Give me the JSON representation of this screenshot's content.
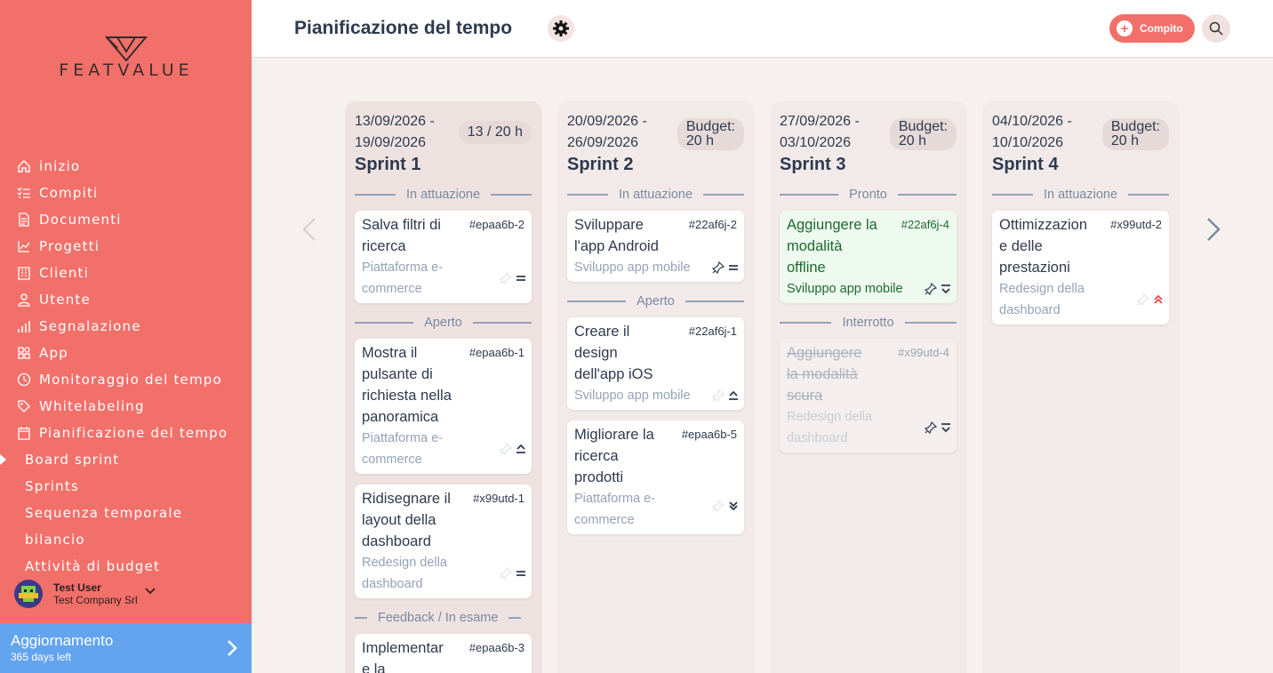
{
  "brand": {
    "name": "FEATVALUE",
    "accent": "#f2706a",
    "upgrade_color": "#63a4ee"
  },
  "sidebar": {
    "items": [
      {
        "label": "inizio",
        "icon": "home-icon"
      },
      {
        "label": "Compiti",
        "icon": "checklist-icon"
      },
      {
        "label": "Documenti",
        "icon": "document-icon"
      },
      {
        "label": "Progetti",
        "icon": "chart-icon"
      },
      {
        "label": "Clienti",
        "icon": "building-icon"
      },
      {
        "label": "Utente",
        "icon": "user-icon"
      },
      {
        "label": "Segnalazione",
        "icon": "bar-chart-icon"
      },
      {
        "label": "App",
        "icon": "apps-icon"
      },
      {
        "label": "Monitoraggio del tempo",
        "icon": "clock-icon"
      },
      {
        "label": "Whitelabeling",
        "icon": "tag-icon"
      },
      {
        "label": "Pianificazione del tempo",
        "icon": "calendar-icon"
      }
    ],
    "subitems": [
      {
        "label": "Board sprint",
        "active": true
      },
      {
        "label": "Sprints"
      },
      {
        "label": "Sequenza temporale"
      },
      {
        "label": "bilancio"
      },
      {
        "label": "Attività di budget"
      }
    ],
    "user": {
      "name": "Test User",
      "company": "Test Company Srl"
    },
    "upgrade": {
      "title": "Aggiornamento",
      "subtitle": "365 days left"
    }
  },
  "header": {
    "title": "Pianificazione del tempo",
    "add_label": "Compito"
  },
  "columns": [
    {
      "dates": [
        "13/09/2026 -",
        "19/09/2026"
      ],
      "budget": [
        "13 / 20 h"
      ],
      "title": "Sprint 1",
      "groups": [
        "In attuazione",
        "Aperto",
        "Feedback / In esame"
      ],
      "cards": [
        {
          "title": [
            "Salva filtri di",
            "ricerca"
          ],
          "id": "#epaa6b-2",
          "project": [
            "Piattaforma e-",
            "commerce"
          ],
          "priority": "medium"
        },
        {
          "title": [
            "Mostra il",
            "pulsante di",
            "richiesta nella",
            "panoramica"
          ],
          "id": "#epaa6b-1",
          "project": [
            "Piattaforma e-",
            "commerce"
          ],
          "priority": "up"
        },
        {
          "title": [
            "Ridisegnare il",
            "layout della",
            "dashboard"
          ],
          "id": "#x99utd-1",
          "project": [
            "Redesign della",
            "dashboard"
          ],
          "priority": "medium"
        },
        {
          "title": [
            "Implementar",
            "e la"
          ],
          "id": "#epaa6b-3",
          "project": [],
          "priority": ""
        }
      ]
    },
    {
      "dates": [
        "20/09/2026 -",
        "26/09/2026"
      ],
      "budget": [
        "Budget:",
        "20 h"
      ],
      "title": "Sprint 2",
      "groups": [
        "In attuazione",
        "Aperto"
      ],
      "cards": [
        {
          "title": [
            "Sviluppare",
            "l'app Android"
          ],
          "id": "#22af6j-2",
          "project": [
            "Sviluppo app mobile"
          ],
          "priority": "medium"
        },
        {
          "title": [
            "Creare il",
            "design",
            "dell'app iOS"
          ],
          "id": "#22af6j-1",
          "project": [
            "Sviluppo app mobile"
          ],
          "priority": "up"
        },
        {
          "title": [
            "Migliorare la",
            "ricerca",
            "prodotti"
          ],
          "id": "#epaa6b-5",
          "project": [
            "Piattaforma e-",
            "commerce"
          ],
          "priority": "double-down"
        }
      ]
    },
    {
      "dates": [
        "27/09/2026 -",
        "03/10/2026"
      ],
      "budget": [
        "Budget:",
        "20 h"
      ],
      "title": "Sprint 3",
      "groups": [
        "Pronto",
        "Interrotto"
      ],
      "cards": [
        {
          "title": [
            "Aggiungere la",
            "modalità",
            "offline"
          ],
          "id": "#22af6j-4",
          "project": [
            "Sviluppo app mobile"
          ],
          "priority": "down"
        },
        {
          "title": [
            "Aggiungere",
            "la modalità",
            "scura"
          ],
          "id": "#x99utd-4",
          "project": [
            "Redesign della",
            "dashboard"
          ],
          "priority": "down"
        }
      ]
    },
    {
      "dates": [
        "04/10/2026 -",
        "10/10/2026"
      ],
      "budget": [
        "Budget:",
        "20 h"
      ],
      "title": "Sprint 4",
      "groups": [
        "In attuazione"
      ],
      "cards": [
        {
          "title": [
            "Ottimizzazion",
            "e delle",
            "prestazioni"
          ],
          "id": "#x99utd-2",
          "project": [
            "Redesign della",
            "dashboard"
          ],
          "priority": "double-up"
        }
      ]
    }
  ]
}
